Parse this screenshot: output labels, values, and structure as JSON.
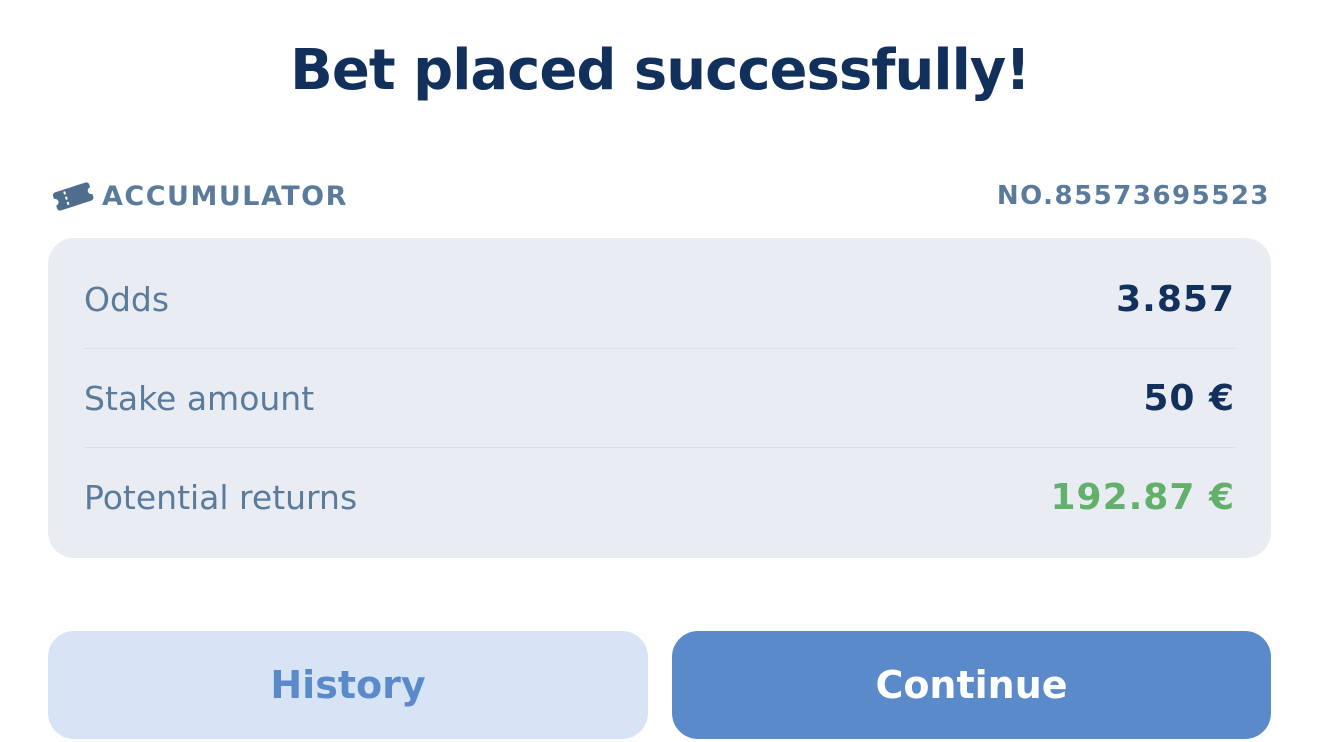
{
  "title": "Bet placed successfully!",
  "bet": {
    "type_icon": "ticket-icon",
    "type_label": "ACCUMULATOR",
    "number": "NO.85573695523"
  },
  "summary": {
    "rows": [
      {
        "label": "Odds",
        "value": "3.857"
      },
      {
        "label": "Stake amount",
        "value": "50 €"
      },
      {
        "label": "Potential returns",
        "value": "192.87 €"
      }
    ]
  },
  "actions": {
    "history_label": "History",
    "continue_label": "Continue"
  },
  "colors": {
    "title": "#12305c",
    "muted": "#5a7b9c",
    "card_bg": "#e9edf3",
    "positive": "#62b06b",
    "primary": "#5b8acb",
    "secondary_bg": "#d6e4f5"
  }
}
